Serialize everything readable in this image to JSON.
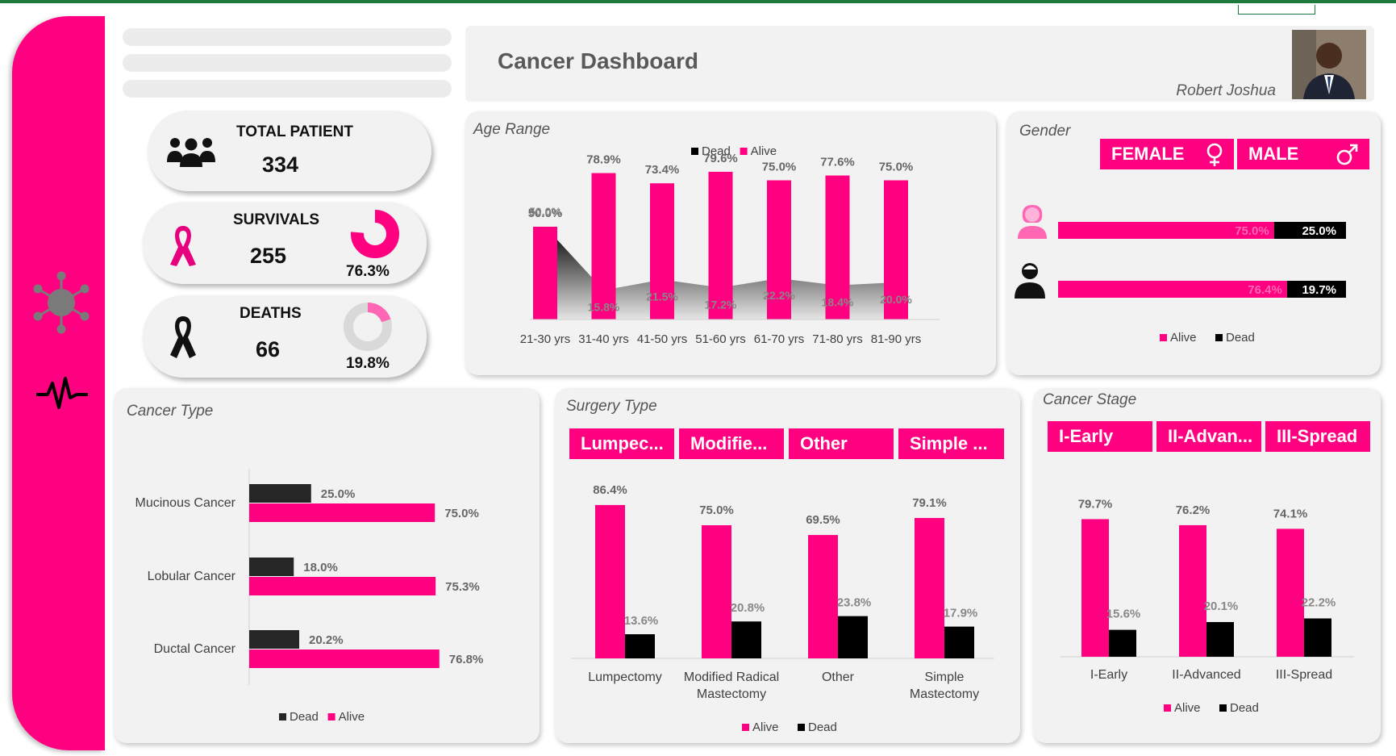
{
  "header": {
    "title": "Cancer Dashboard",
    "author": "Robert Joshua"
  },
  "kpis": {
    "total": {
      "label": "TOTAL PATIENT",
      "value": "334"
    },
    "survivals": {
      "label": "SURVIVALS",
      "value": "255",
      "pct": "76.3%",
      "fraction": 0.763
    },
    "deaths": {
      "label": "DEATHS",
      "value": "66",
      "pct": "19.8%",
      "fraction": 0.198
    }
  },
  "gender": {
    "title": "Gender",
    "buttons": [
      "FEMALE",
      "MALE"
    ],
    "legend": [
      "Alive",
      "Dead"
    ]
  },
  "surgery_buttons": [
    "Lumpec...",
    "Modifie...",
    "Other",
    "Simple ..."
  ],
  "stage_buttons": [
    "I-Early",
    "II-Advan...",
    "III-Spread"
  ],
  "colors": {
    "accent": "#ff0080",
    "dead": "#000000",
    "panel": "#f2f2f2"
  },
  "chart_data": [
    {
      "id": "age",
      "type": "bar",
      "title": "Age Range",
      "legend": [
        "Dead",
        "Alive"
      ],
      "categories": [
        "21-30 yrs",
        "31-40 yrs",
        "41-50 yrs",
        "51-60 yrs",
        "61-70 yrs",
        "71-80 yrs",
        "81-90 yrs"
      ],
      "series": [
        {
          "name": "Alive",
          "values": [
            50.0,
            78.9,
            73.4,
            79.6,
            75.0,
            77.6,
            75.0
          ],
          "labels": [
            "50.0%",
            "78.9%",
            "73.4%",
            "79.6%",
            "75.0%",
            "77.6%",
            "75.0%"
          ]
        },
        {
          "name": "Dead",
          "values": [
            50.0,
            15.8,
            21.5,
            17.2,
            22.2,
            18.4,
            20.0
          ],
          "labels": [
            "50.0%",
            "15.8%",
            "21.5%",
            "17.2%",
            "22.2%",
            "18.4%",
            "20.0%"
          ]
        }
      ],
      "ylim": [
        0,
        100
      ]
    },
    {
      "id": "gender",
      "type": "bar",
      "orientation": "horizontal-stacked",
      "categories": [
        "Female",
        "Male"
      ],
      "series": [
        {
          "name": "Alive",
          "values": [
            75.0,
            76.4
          ],
          "labels": [
            "75.0%",
            "76.4%"
          ]
        },
        {
          "name": "Dead",
          "values": [
            25.0,
            19.7
          ],
          "labels": [
            "25.0%",
            "19.7%"
          ]
        }
      ]
    },
    {
      "id": "cancer_type",
      "type": "bar",
      "orientation": "horizontal",
      "title": "Cancer Type",
      "legend": [
        "Dead",
        "Alive"
      ],
      "categories": [
        "Mucinous Cancer",
        "Lobular Cancer",
        "Ductal Cancer"
      ],
      "series": [
        {
          "name": "Dead",
          "values": [
            25.0,
            18.0,
            20.2
          ],
          "labels": [
            "25.0%",
            "18.0%",
            "20.2%"
          ]
        },
        {
          "name": "Alive",
          "values": [
            75.0,
            75.3,
            76.8
          ],
          "labels": [
            "75.0%",
            "75.3%",
            "76.8%"
          ]
        }
      ]
    },
    {
      "id": "surgery",
      "type": "bar",
      "title": "Surgery Type",
      "legend": [
        "Alive",
        "Dead"
      ],
      "categories": [
        [
          "Lumpectomy"
        ],
        [
          "Modified Radical",
          "Mastectomy"
        ],
        [
          "Other"
        ],
        [
          "Simple",
          "Mastectomy"
        ]
      ],
      "series": [
        {
          "name": "Alive",
          "values": [
            86.4,
            75.0,
            69.5,
            79.1
          ],
          "labels": [
            "86.4%",
            "75.0%",
            "69.5%",
            "79.1%"
          ]
        },
        {
          "name": "Dead",
          "values": [
            13.6,
            20.8,
            23.8,
            17.9
          ],
          "labels": [
            "13.6%",
            "20.8%",
            "23.8%",
            "17.9%"
          ]
        }
      ]
    },
    {
      "id": "stage",
      "type": "bar",
      "title": "Cancer Stage",
      "legend": [
        "Alive",
        "Dead"
      ],
      "categories": [
        "I-Early",
        "II-Advanced",
        "III-Spread"
      ],
      "series": [
        {
          "name": "Alive",
          "values": [
            79.7,
            76.2,
            74.1
          ],
          "labels": [
            "79.7%",
            "76.2%",
            "74.1%"
          ]
        },
        {
          "name": "Dead",
          "values": [
            15.6,
            20.1,
            22.2
          ],
          "labels": [
            "15.6%",
            "20.1%",
            "22.2%"
          ]
        }
      ]
    }
  ]
}
